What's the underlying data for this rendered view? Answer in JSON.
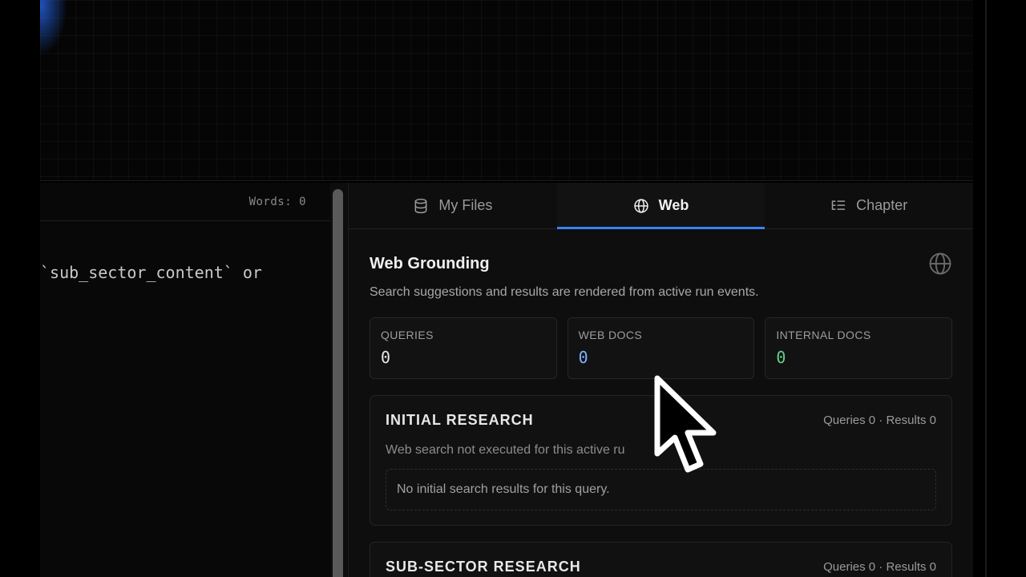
{
  "editor": {
    "word_count": "Words: 0",
    "visible_line": "`sub_sector_content` or"
  },
  "tabs": [
    {
      "label": "My Files",
      "icon": "database-icon",
      "active": false
    },
    {
      "label": "Web",
      "icon": "globe-icon",
      "active": true
    },
    {
      "label": "Chapter",
      "icon": "list-tree-icon",
      "active": false
    }
  ],
  "panel": {
    "title": "Web Grounding",
    "subtitle": "Search suggestions and results are rendered from active run events."
  },
  "stats": [
    {
      "label": "QUERIES",
      "value": "0",
      "color": "#e6e6e6"
    },
    {
      "label": "WEB DOCS",
      "value": "0",
      "color": "#7fb2ff"
    },
    {
      "label": "INTERNAL DOCS",
      "value": "0",
      "color": "#5fd38a"
    }
  ],
  "sections": [
    {
      "title": "INITIAL RESEARCH",
      "meta": "Queries 0 · Results 0",
      "note": "Web search not executed for this active ru",
      "empty": "No initial search results for this query."
    },
    {
      "title": "SUB-SECTOR RESEARCH",
      "meta": "Queries 0 · Results 0"
    }
  ],
  "colors": {
    "accent": "#3b82f6",
    "background": "#000000",
    "panel": "#0e0e0e"
  }
}
